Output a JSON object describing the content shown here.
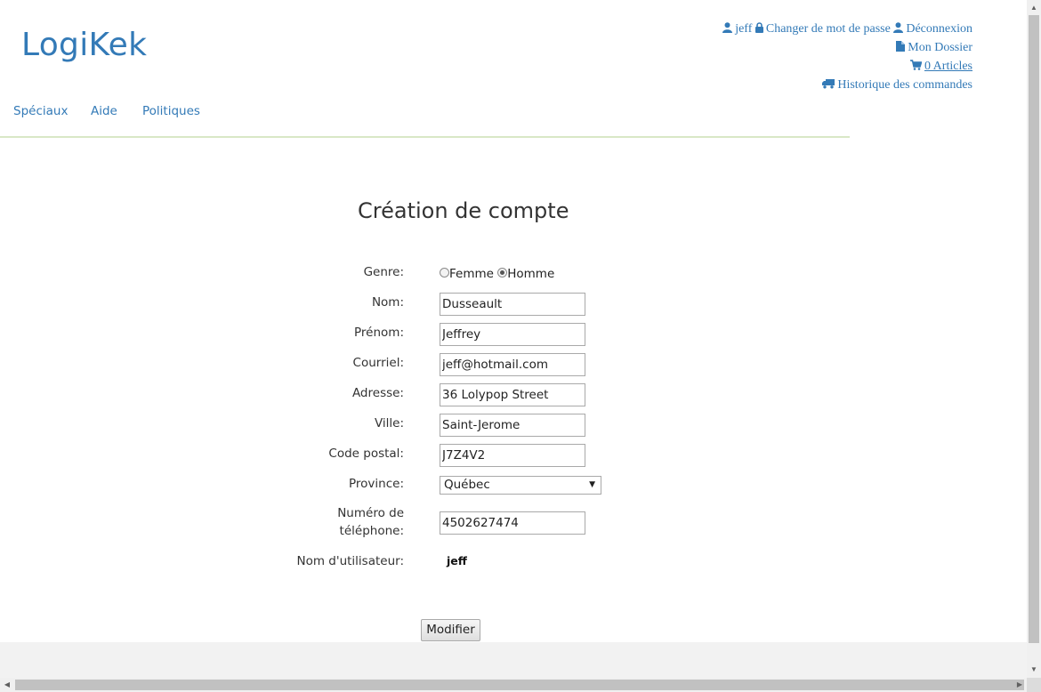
{
  "header": {
    "logo": "LogiKek",
    "user_links": {
      "username": "jeff",
      "change_password": "Changer de mot de passe",
      "logout": "Déconnexion",
      "my_folder": "Mon Dossier",
      "cart": "0 Articles",
      "order_history": "Historique des commandes"
    }
  },
  "nav": {
    "items": [
      "Spéciaux",
      "Aide",
      "Politiques"
    ]
  },
  "form": {
    "title": "Création de compte",
    "labels": {
      "genre": "Genre:",
      "nom": "Nom:",
      "prenom": "Prénom:",
      "courriel": "Courriel:",
      "adresse": "Adresse:",
      "ville": "Ville:",
      "code_postal": "Code postal:",
      "province": "Province:",
      "telephone_1": "Numéro de",
      "telephone_2": "téléphone:",
      "username": "Nom d'utilisateur:"
    },
    "genre_options": [
      "Femme",
      "Homme"
    ],
    "genre_selected": "Homme",
    "values": {
      "nom": "Dusseault",
      "prenom": "Jeffrey",
      "courriel": "jeff@hotmail.com",
      "adresse": "36 Lolypop Street",
      "ville": "Saint-Jerome",
      "code_postal": "J7Z4V2",
      "province": "Québec",
      "telephone": "4502627474",
      "username": "jeff"
    },
    "submit_label": "Modifier"
  },
  "colors": {
    "link": "#337ab7",
    "nav_underline": "#d9e8c6"
  },
  "icons": [
    "user-icon",
    "lock-icon",
    "file-icon",
    "cart-icon",
    "truck-icon",
    "chevron-down-icon"
  ]
}
